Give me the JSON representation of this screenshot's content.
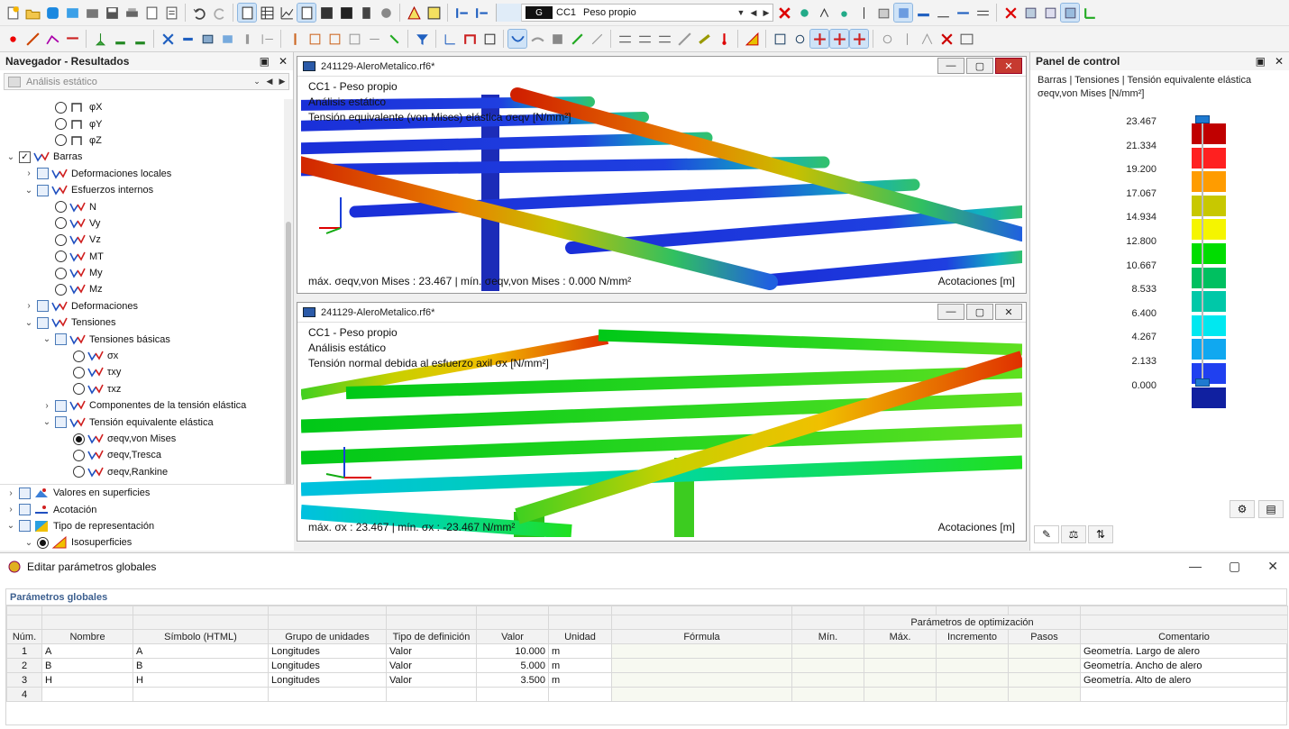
{
  "load_case": {
    "group": "G",
    "id": "CC1",
    "name": "Peso propio"
  },
  "navigator": {
    "title": "Navegador - Resultados",
    "analysis": "Análisis estático",
    "items": [
      {
        "label": "φX",
        "level": 2,
        "type": "radio",
        "icon": "rotation-icon"
      },
      {
        "label": "φY",
        "level": 2,
        "type": "radio",
        "icon": "rotation-icon"
      },
      {
        "label": "φZ",
        "level": 2,
        "type": "radio",
        "icon": "rotation-icon"
      },
      {
        "label": "Barras",
        "level": 0,
        "type": "check",
        "checked": true,
        "exp": "v",
        "icon": "member-icon"
      },
      {
        "label": "Deformaciones locales",
        "level": 1,
        "type": "check",
        "exp": ">",
        "icon": "member-icon"
      },
      {
        "label": "Esfuerzos internos",
        "level": 1,
        "type": "check",
        "exp": "v",
        "icon": "member-icon"
      },
      {
        "label": "N",
        "level": 2,
        "type": "radio",
        "icon": "member-icon"
      },
      {
        "label": "Vy",
        "level": 2,
        "type": "radio",
        "icon": "member-icon"
      },
      {
        "label": "Vz",
        "level": 2,
        "type": "radio",
        "icon": "member-icon"
      },
      {
        "label": "MT",
        "level": 2,
        "type": "radio",
        "icon": "member-icon"
      },
      {
        "label": "My",
        "level": 2,
        "type": "radio",
        "icon": "member-icon"
      },
      {
        "label": "Mz",
        "level": 2,
        "type": "radio",
        "icon": "member-icon"
      },
      {
        "label": "Deformaciones",
        "level": 1,
        "type": "check",
        "exp": ">",
        "icon": "member-icon"
      },
      {
        "label": "Tensiones",
        "level": 1,
        "type": "check",
        "exp": "v",
        "icon": "member-icon"
      },
      {
        "label": "Tensiones básicas",
        "level": 2,
        "type": "check",
        "exp": "v",
        "icon": "member-icon"
      },
      {
        "label": "σx",
        "level": 3,
        "type": "radio",
        "icon": "member-icon"
      },
      {
        "label": "τxy",
        "level": 3,
        "type": "radio",
        "icon": "member-icon"
      },
      {
        "label": "τxz",
        "level": 3,
        "type": "radio",
        "icon": "member-icon"
      },
      {
        "label": "Componentes de la tensión elástica",
        "level": 2,
        "type": "check",
        "exp": ">",
        "icon": "member-icon"
      },
      {
        "label": "Tensión equivalente elástica",
        "level": 2,
        "type": "check",
        "exp": "v",
        "icon": "member-icon"
      },
      {
        "label": "σeqv,von Mises",
        "level": 3,
        "type": "radio",
        "on": true,
        "icon": "member-icon"
      },
      {
        "label": "σeqv,Tresca",
        "level": 3,
        "type": "radio",
        "icon": "member-icon"
      },
      {
        "label": "σeqv,Rankine",
        "level": 3,
        "type": "radio",
        "icon": "member-icon"
      }
    ],
    "bottom_items": [
      {
        "label": "Valores en superficies",
        "exp": ">",
        "icon": "surface-icon"
      },
      {
        "label": "Acotación",
        "exp": ">",
        "icon": "dimension-icon"
      },
      {
        "label": "Tipo de representación",
        "exp": "v",
        "icon": "display-type-icon"
      },
      {
        "label": "Isosuperficies",
        "exp": "v",
        "radio": true,
        "icon": "isosurface-icon"
      }
    ]
  },
  "view1": {
    "title": "241129-AleroMetalico.rf6*",
    "line1": "CC1 - Peso propio",
    "line2": "Análisis estático",
    "line3": "Tensión equivalente (von Mises) elástica σeqv [N/mm²]",
    "footer": "máx. σeqv,von Mises : 23.467 | mín. σeqv,von Mises : 0.000 N/mm²",
    "dims": "Acotaciones [m]"
  },
  "view2": {
    "title": "241129-AleroMetalico.rf6*",
    "line1": "CC1 - Peso propio",
    "line2": "Análisis estático",
    "line3": "Tensión normal debida al esfuerzo axil σx [N/mm²]",
    "footer": "máx. σx : 23.467 | mín. σx : -23.467 N/mm²",
    "dims": "Acotaciones [m]"
  },
  "control_panel": {
    "title": "Panel de control",
    "subtitle": "Barras | Tensiones | Tensión equivalente elástica",
    "quantity": "σeqv,von Mises [N/mm²]",
    "legend_values": [
      "23.467",
      "21.334",
      "19.200",
      "17.067",
      "14.934",
      "12.800",
      "10.667",
      "8.533",
      "6.400",
      "4.267",
      "2.133",
      "0.000"
    ],
    "legend_colors": [
      "#c00000",
      "#ff2020",
      "#ff9c00",
      "#c8c800",
      "#f5f500",
      "#00dd00",
      "#00c060",
      "#00c8a8",
      "#00e8f0",
      "#10a8f0",
      "#2040f0",
      "#1020a0"
    ]
  },
  "dialog": {
    "title": "Editar parámetros globales",
    "section": "Parámetros globales",
    "opt_group": "Parámetros de optimización",
    "columns": [
      "Núm.",
      "Nombre",
      "Símbolo (HTML)",
      "Grupo de unidades",
      "Tipo de definición",
      "Valor",
      "Unidad",
      "Fórmula",
      "Mín.",
      "Máx.",
      "Incremento",
      "Pasos",
      "Comentario"
    ],
    "rows": [
      {
        "num": "1",
        "name": "A",
        "symbol": "A",
        "group": "Longitudes",
        "def": "Valor",
        "value": "10.000",
        "unit": "m",
        "comment": "Geometría. Largo de alero"
      },
      {
        "num": "2",
        "name": "B",
        "symbol": "B",
        "group": "Longitudes",
        "def": "Valor",
        "value": "5.000",
        "unit": "m",
        "comment": "Geometría. Ancho de alero"
      },
      {
        "num": "3",
        "name": "H",
        "symbol": "H",
        "group": "Longitudes",
        "def": "Valor",
        "value": "3.500",
        "unit": "m",
        "comment": "Geometría. Alto de alero"
      },
      {
        "num": "4",
        "name": "",
        "symbol": "",
        "group": "",
        "def": "",
        "value": "",
        "unit": "",
        "comment": ""
      }
    ]
  }
}
